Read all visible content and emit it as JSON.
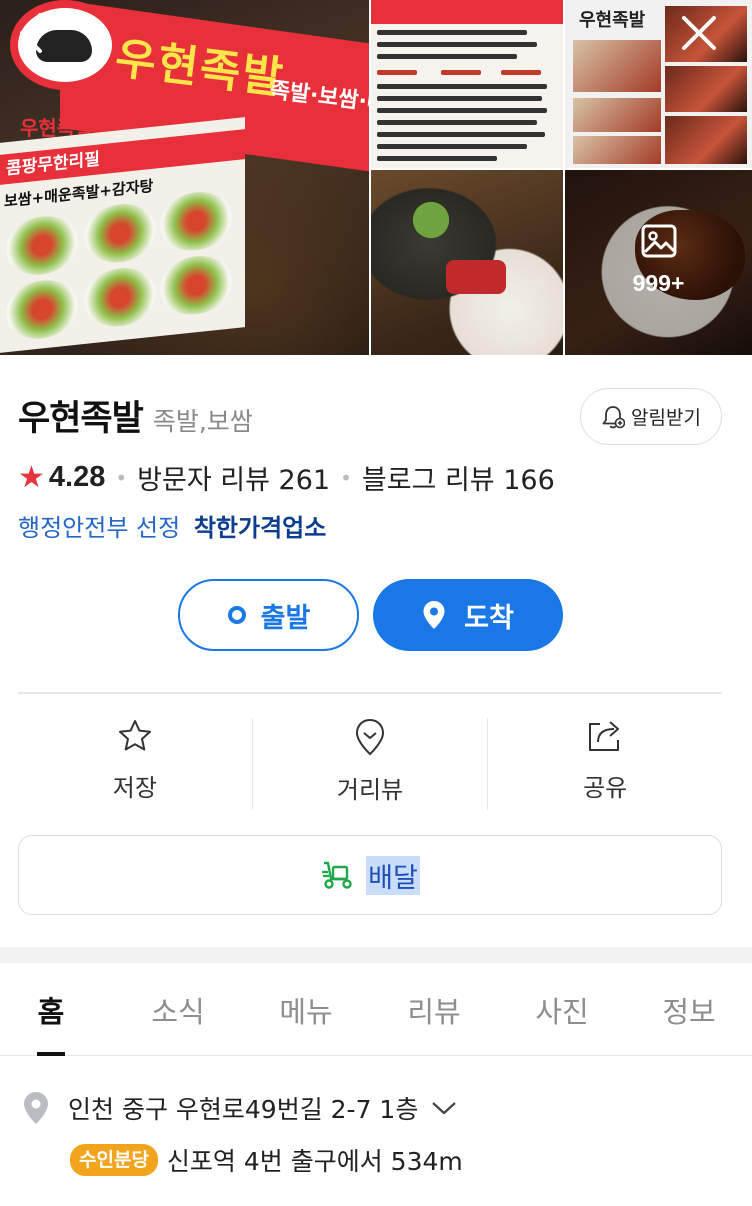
{
  "photos": {
    "main_sign_text": "우현족발",
    "main_sign_sub": "족발·보쌈·매운족발",
    "main_board_title": "콤팡무한리필",
    "main_board_sub": "보쌈+매운족발+감자탕",
    "main_small_name": "우현족발",
    "tv_title": "우현족발",
    "more_count": "999+"
  },
  "header": {
    "back_icon": "chevron-left-icon",
    "close_icon": "close-icon"
  },
  "place": {
    "name": "우현족발",
    "category": "족발,보쌈",
    "alarm_label": "알림받기",
    "rating": "4.28",
    "visitor_review": "방문자 리뷰 261",
    "blog_review": "블로그 리뷰 166",
    "gov_label": "행정안전부 선정",
    "gov_badge": "착한가격업소"
  },
  "route": {
    "depart_label": "출발",
    "arrive_label": "도착"
  },
  "actions": {
    "save_label": "저장",
    "streetview_label": "거리뷰",
    "share_label": "공유"
  },
  "delivery": {
    "label": "배달"
  },
  "tabs": [
    "홈",
    "소식",
    "메뉴",
    "리뷰",
    "사진",
    "정보"
  ],
  "location": {
    "address": "인천 중구 우현로49번길 2-7 1층",
    "line_badge": "수인분당",
    "station_text": "신포역 4번 출구에서 534m"
  },
  "colors": {
    "accent_blue": "#1a78e6",
    "star_red": "#e8343b",
    "badge_orange": "#f2a51c",
    "delivery_green": "#1fa84a"
  }
}
